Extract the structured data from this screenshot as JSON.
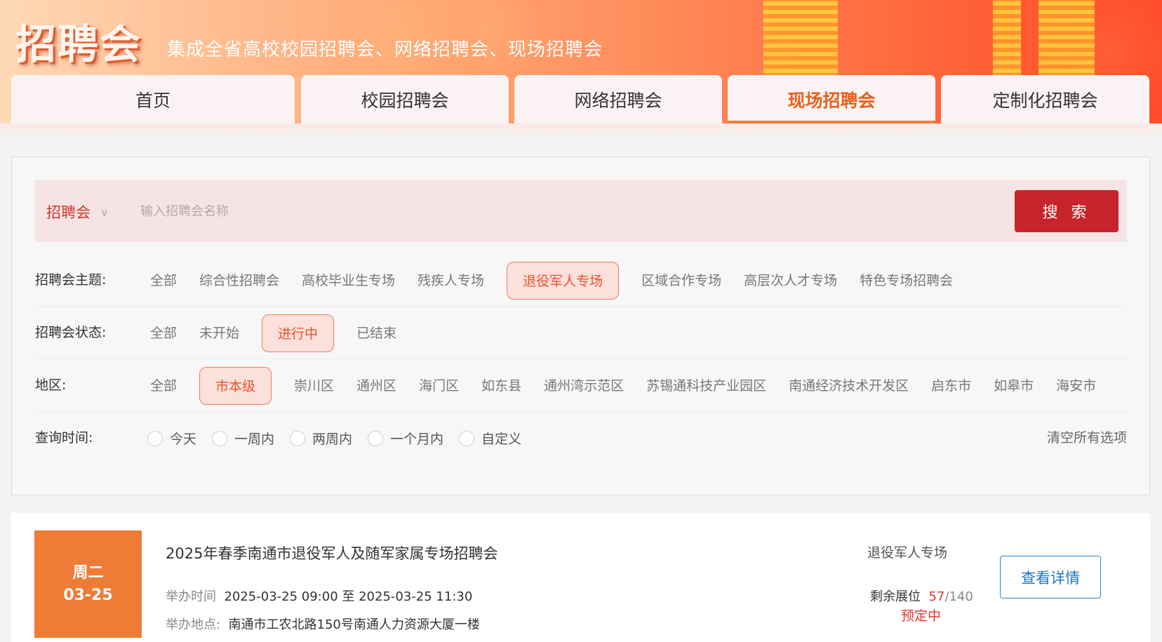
{
  "header": {
    "logo_text": "招聘会",
    "slogan": "集成全省高校校园招聘会、网络招聘会、现场招聘会"
  },
  "nav": {
    "tabs": [
      {
        "label": "首页",
        "active": false
      },
      {
        "label": "校园招聘会",
        "active": false
      },
      {
        "label": "网络招聘会",
        "active": false
      },
      {
        "label": "现场招聘会",
        "active": true
      },
      {
        "label": "定制化招聘会",
        "active": false
      }
    ]
  },
  "search": {
    "type_label": "招聘会",
    "placeholder": "输入招聘会名称",
    "value": "",
    "button_label": "搜 索"
  },
  "filters": {
    "theme": {
      "label": "招聘会主题:",
      "options": [
        "全部",
        "综合性招聘会",
        "高校毕业生专场",
        "残疾人专场",
        "退役军人专场",
        "区域合作专场",
        "高层次人才专场",
        "特色专场招聘会"
      ],
      "selected": "退役军人专场"
    },
    "status": {
      "label": "招聘会状态:",
      "options": [
        "全部",
        "未开始",
        "进行中",
        "已结束"
      ],
      "selected": "进行中"
    },
    "region": {
      "label": "地区:",
      "options": [
        "全部",
        "市本级",
        "崇川区",
        "通州区",
        "海门区",
        "如东县",
        "通州湾示范区",
        "苏锡通科技产业园区",
        "南通经济技术开发区",
        "启东市",
        "如皋市",
        "海安市"
      ],
      "selected": "市本级"
    },
    "time": {
      "label": "查询时间:",
      "options": [
        "今天",
        "一周内",
        "两周内",
        "一个月内",
        "自定义"
      ],
      "selected": null
    },
    "clear_label": "清空所有选项"
  },
  "results": [
    {
      "weekday": "周二",
      "date": "03-25",
      "title": "2025年春季南通市退役军人及随军家属专场招聘会",
      "time_label": "举办时间",
      "time_value": "2025-03-25 09:00 至 2025-03-25 11:30",
      "place_label": "举办地点:",
      "place_value": "南通市工农北路150号南通人力资源大厦一楼",
      "tag": "退役军人专场",
      "booth_label": "剩余展位",
      "booth_left": "57",
      "booth_total": "140",
      "booth_status": "预定中",
      "detail_label": "查看详情"
    }
  ],
  "colors": {
    "accent": "#ee7b36",
    "search_button": "#c8242c",
    "active_tab_text": "#e8601c",
    "detail_button": "#1f72c8",
    "highlight_red": "#e0342f"
  }
}
